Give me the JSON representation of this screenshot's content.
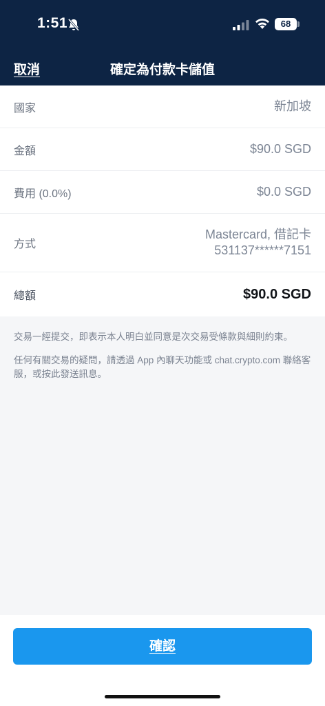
{
  "status_bar": {
    "time": "1:51",
    "battery": "68",
    "icons": [
      "bell-slash-icon",
      "signal-icon",
      "wifi-icon",
      "battery-icon"
    ]
  },
  "header": {
    "cancel_label": "取消",
    "title": "確定為付款卡儲值"
  },
  "details": {
    "country": {
      "label": "國家",
      "value": "新加坡"
    },
    "amount": {
      "label": "金額",
      "value": "$90.0 SGD"
    },
    "fee": {
      "label": "費用 (0.0%)",
      "value": "$0.0 SGD"
    },
    "method": {
      "label": "方式",
      "value_line1": "Mastercard, 借記卡",
      "value_line2": "531137******7151"
    },
    "total": {
      "label": "總額",
      "value": "$90.0 SGD"
    }
  },
  "notes": {
    "terms": "交易一經提交，即表示本人明白並同意是次交易受條款與細則約束。",
    "support": "任何有關交易的疑問，請透過 App 內聊天功能或 chat.crypto.com 聯絡客服，或按此發送訊息。"
  },
  "footer": {
    "confirm_label": "確認"
  },
  "colors": {
    "header_bg": "#0d2444",
    "button_bg": "#1a97ee",
    "page_bg": "#f5f6f8"
  }
}
